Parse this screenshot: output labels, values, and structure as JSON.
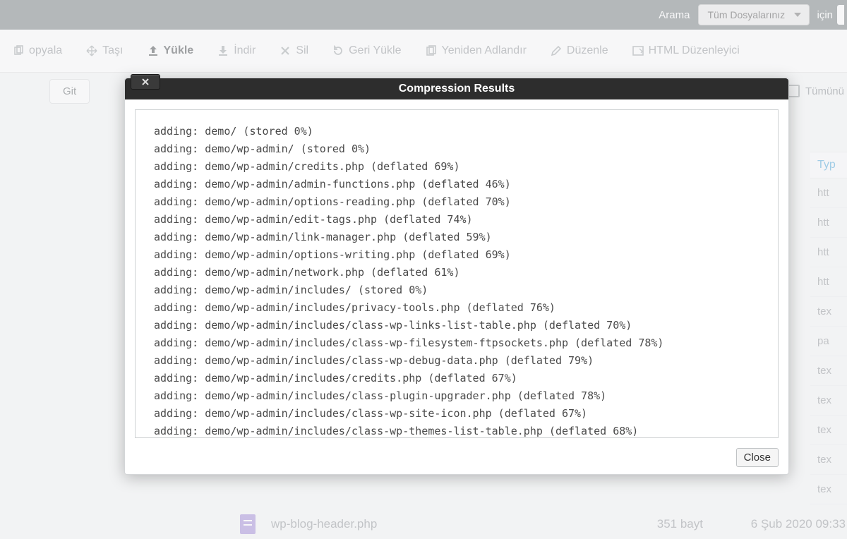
{
  "topbar": {
    "search_label": "Arama",
    "dropdown_selected": "Tüm Dosyalarınız",
    "after_label": "için"
  },
  "toolbar": {
    "copy": "opyala",
    "move": "Taşı",
    "upload": "Yükle",
    "download": "İndir",
    "delete": "Sil",
    "restore": "Geri Yükle",
    "rename": "Yeniden Adlandır",
    "edit": "Düzenle",
    "html_editor": "HTML Düzenleyici"
  },
  "breadcrumb": {
    "go_label": "Git",
    "select_all_label": "Tümünü"
  },
  "right_column": {
    "header": "Typ",
    "cells": [
      "htt",
      "htt",
      "htt",
      "htt",
      "tex",
      "pa",
      "tex",
      "tex",
      "tex",
      "tex",
      "tex"
    ]
  },
  "file_row": {
    "name": "wp-blog-header.php",
    "size": "351 bayt",
    "date": "6 Şub 2020 09:33"
  },
  "modal": {
    "title": "Compression Results",
    "close_label": "Close",
    "log_lines": [
      "adding: demo/ (stored 0%)",
      "adding: demo/wp-admin/ (stored 0%)",
      "adding: demo/wp-admin/credits.php (deflated 69%)",
      "adding: demo/wp-admin/admin-functions.php (deflated 46%)",
      "adding: demo/wp-admin/options-reading.php (deflated 70%)",
      "adding: demo/wp-admin/edit-tags.php (deflated 74%)",
      "adding: demo/wp-admin/link-manager.php (deflated 59%)",
      "adding: demo/wp-admin/options-writing.php (deflated 69%)",
      "adding: demo/wp-admin/network.php (deflated 61%)",
      "adding: demo/wp-admin/includes/ (stored 0%)",
      "adding: demo/wp-admin/includes/privacy-tools.php (deflated 76%)",
      "adding: demo/wp-admin/includes/class-wp-links-list-table.php (deflated 70%)",
      "adding: demo/wp-admin/includes/class-wp-filesystem-ftpsockets.php (deflated 78%)",
      "adding: demo/wp-admin/includes/class-wp-debug-data.php (deflated 79%)",
      "adding: demo/wp-admin/includes/credits.php (deflated 67%)",
      "adding: demo/wp-admin/includes/class-plugin-upgrader.php (deflated 78%)",
      "adding: demo/wp-admin/includes/class-wp-site-icon.php (deflated 67%)",
      "adding: demo/wp-admin/includes/class-wp-themes-list-table.php (deflated 68%)"
    ]
  }
}
